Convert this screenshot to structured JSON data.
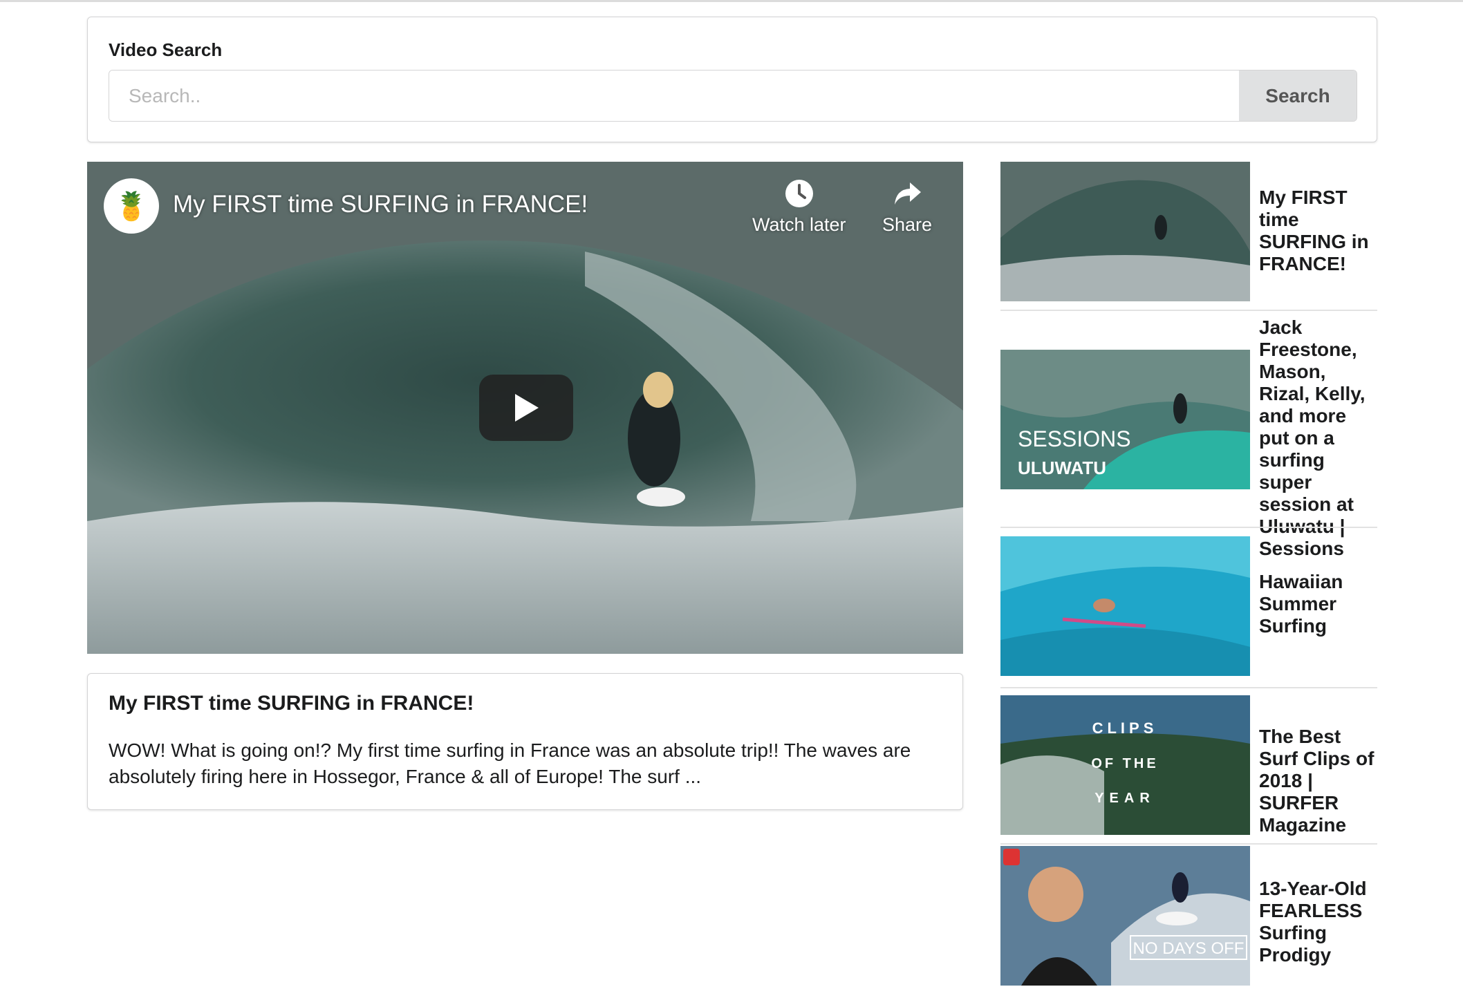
{
  "search": {
    "label": "Video Search",
    "placeholder": "Search..",
    "value": "",
    "button_label": "Search"
  },
  "player": {
    "channel_icon": "pineapple-avatar-icon",
    "title": "My FIRST time SURFING in FRANCE!",
    "watch_later_label": "Watch later",
    "share_label": "Share"
  },
  "selected_video": {
    "title": "My FIRST time SURFING in FRANCE!",
    "description": "WOW! What is going on!? My first time surfing in France was an absolute trip!! The waves are absolutely firing here in Hossegor, France & all of Europe! The surf ..."
  },
  "related_videos": [
    {
      "title": "My FIRST time SURFING in FRANCE!",
      "thumb_text": ""
    },
    {
      "title": "Jack Freestone, Mason, Rizal, Kelly, and more put on a surfing super session at Uluwatu | Sessions",
      "thumb_text": "SESSIONS",
      "thumb_subtext": "ULUWATU"
    },
    {
      "title": "Hawaiian Summer Surfing",
      "thumb_text": ""
    },
    {
      "title": "The Best Surf Clips of 2018 | SURFER Magazine",
      "thumb_text": "CLIPS",
      "thumb_subtext": "OF THE",
      "thumb_subtext2": "YEAR"
    },
    {
      "title": "13-Year-Old FEARLESS Surfing Prodigy",
      "thumb_text": "NO DAYS OFF"
    }
  ],
  "colors": {
    "button_bg": "#e0e1e2",
    "border": "#d4d4d5",
    "text": "#1b1c1d",
    "ocean_teal": "#1fa6c9"
  }
}
